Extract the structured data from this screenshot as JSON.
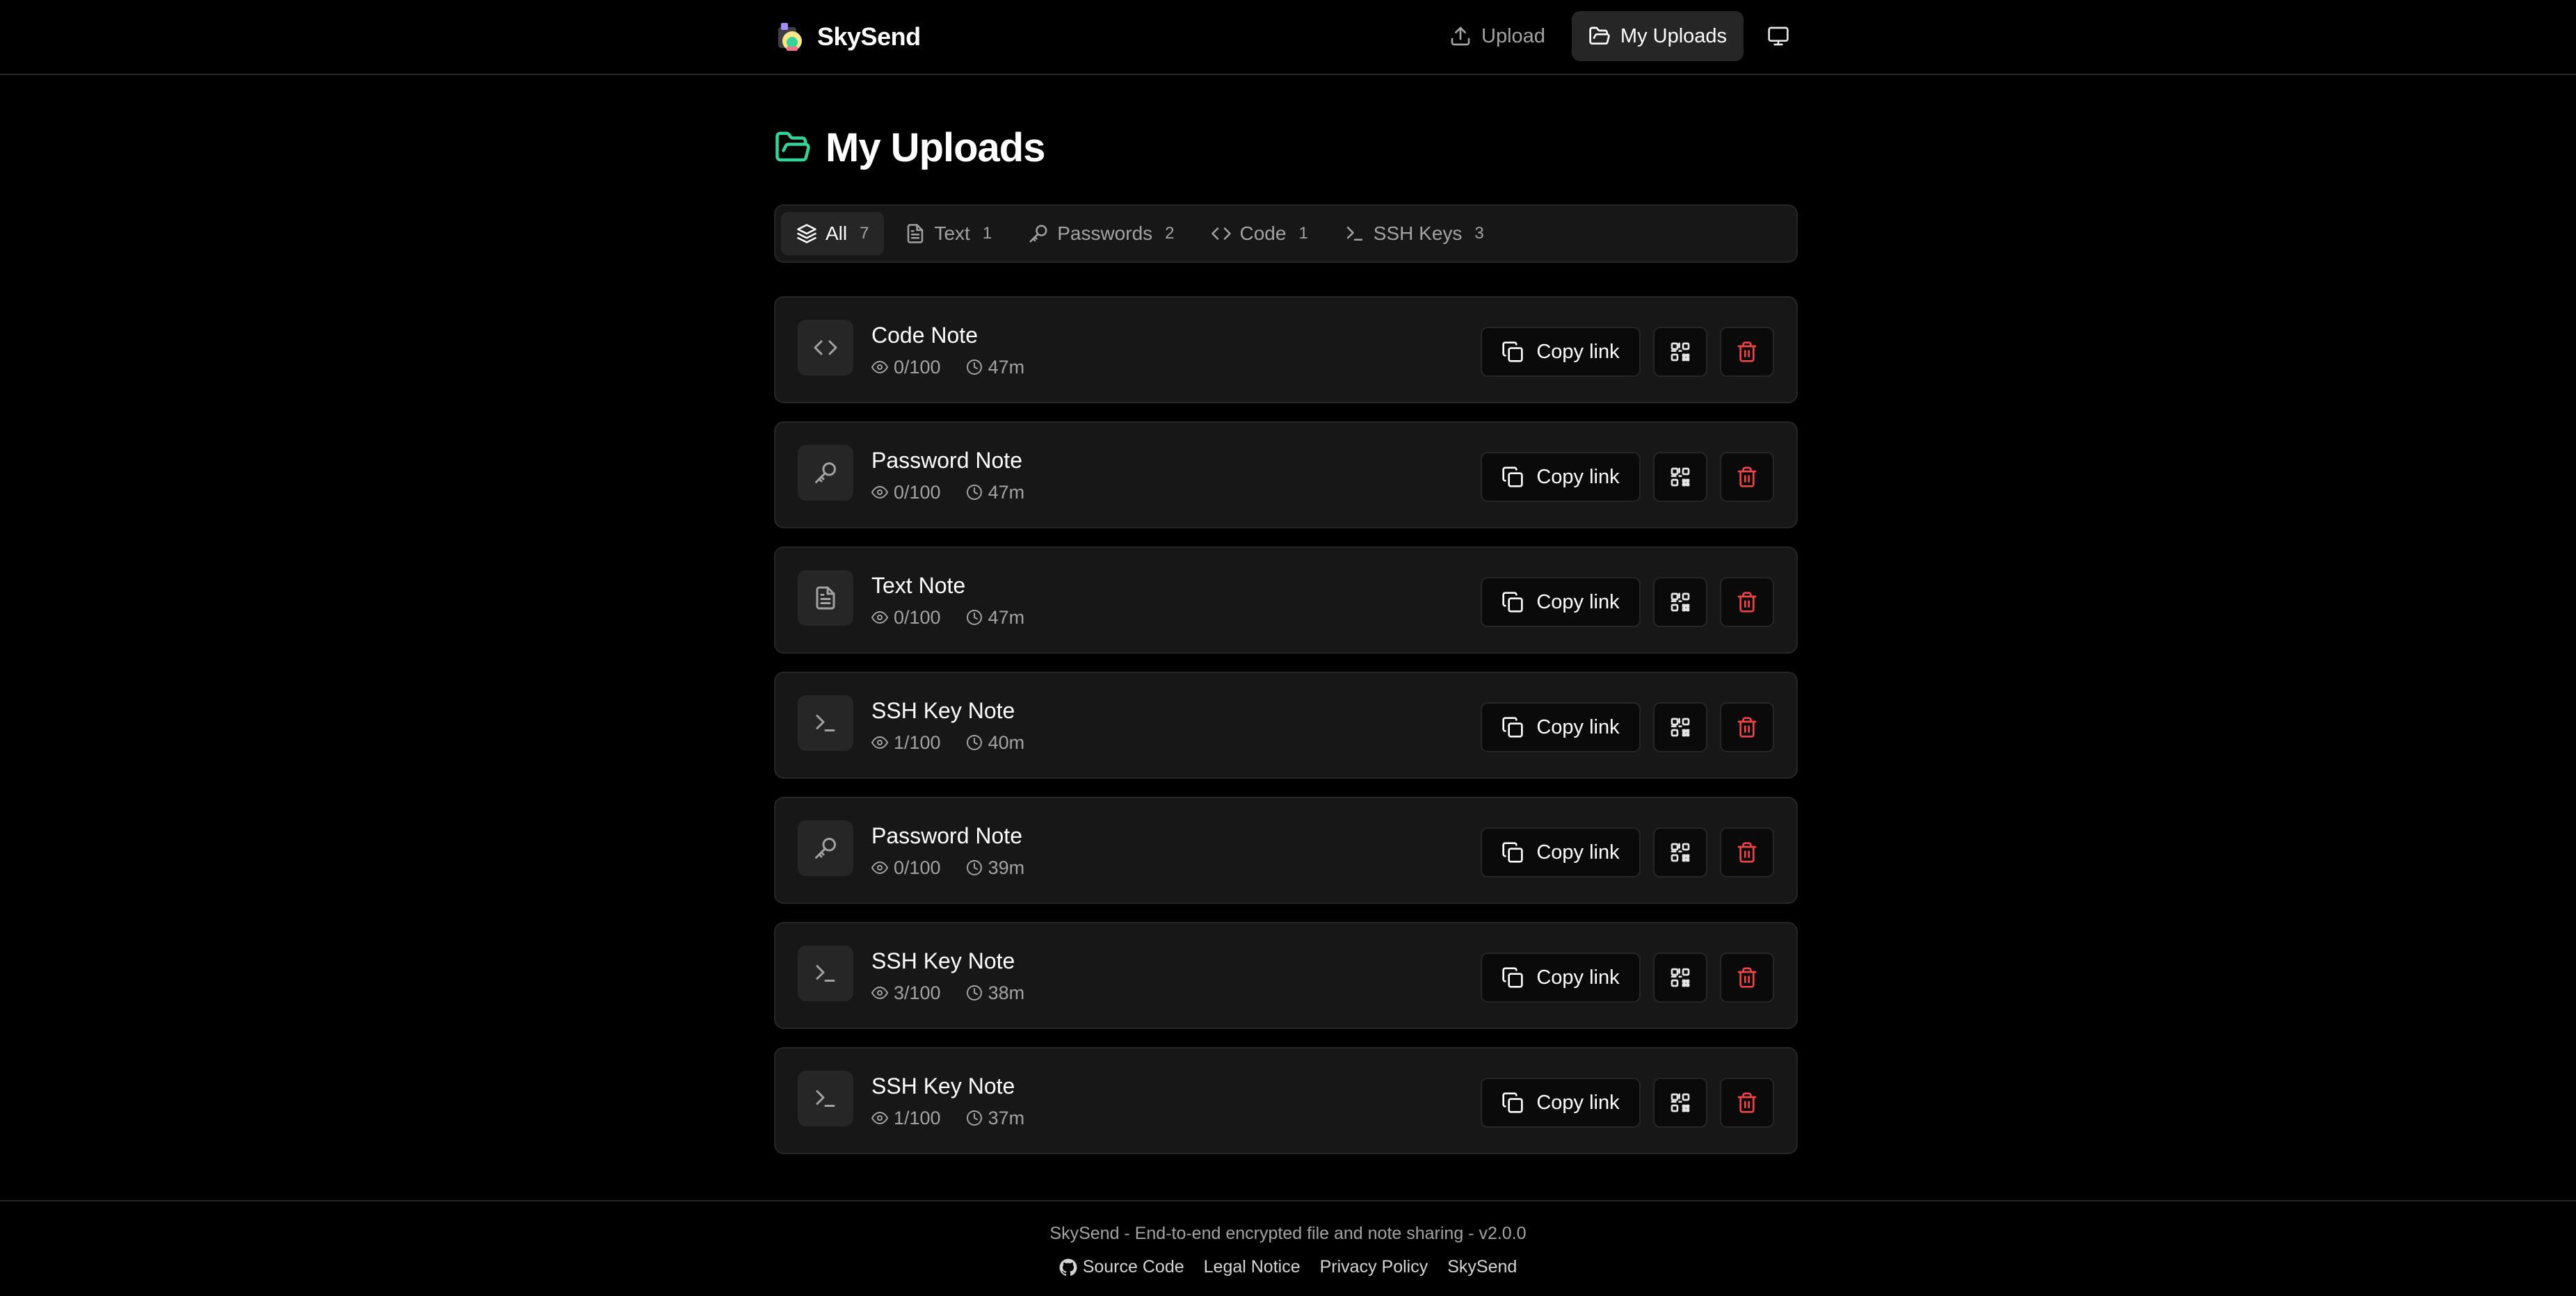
{
  "header": {
    "brand": "SkySend",
    "nav": {
      "upload": "Upload",
      "my_uploads": "My Uploads"
    }
  },
  "page": {
    "title": "My Uploads"
  },
  "tabs": [
    {
      "label": "All",
      "count": "7",
      "icon": "layers-icon",
      "active": true
    },
    {
      "label": "Text",
      "count": "1",
      "icon": "file-text-icon",
      "active": false
    },
    {
      "label": "Passwords",
      "count": "2",
      "icon": "key-icon",
      "active": false
    },
    {
      "label": "Code",
      "count": "1",
      "icon": "code-icon",
      "active": false
    },
    {
      "label": "SSH Keys",
      "count": "3",
      "icon": "terminal-icon",
      "active": false
    }
  ],
  "uploads": [
    {
      "title": "Code Note",
      "views": "0/100",
      "time": "47m",
      "icon": "code-icon"
    },
    {
      "title": "Password Note",
      "views": "0/100",
      "time": "47m",
      "icon": "key-icon"
    },
    {
      "title": "Text Note",
      "views": "0/100",
      "time": "47m",
      "icon": "file-text-icon"
    },
    {
      "title": "SSH Key Note",
      "views": "1/100",
      "time": "40m",
      "icon": "terminal-icon"
    },
    {
      "title": "Password Note",
      "views": "0/100",
      "time": "39m",
      "icon": "key-icon"
    },
    {
      "title": "SSH Key Note",
      "views": "3/100",
      "time": "38m",
      "icon": "terminal-icon"
    },
    {
      "title": "SSH Key Note",
      "views": "1/100",
      "time": "37m",
      "icon": "terminal-icon"
    }
  ],
  "actions": {
    "copy_link": "Copy link"
  },
  "footer": {
    "tagline": "SkySend - End-to-end encrypted file and note sharing - v2.0.0",
    "links": {
      "source_code": "Source Code",
      "legal_notice": "Legal Notice",
      "privacy_policy": "Privacy Policy",
      "skysend": "SkySend"
    }
  },
  "colors": {
    "background": "#000000",
    "card": "#171717",
    "border": "#262626",
    "accent_green": "#34d399",
    "danger": "#ef4444"
  }
}
